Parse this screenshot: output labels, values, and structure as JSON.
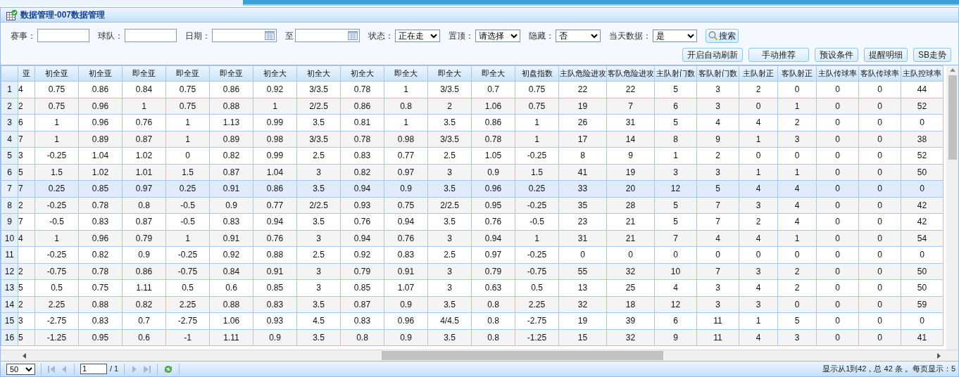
{
  "panel": {
    "title": "数据管理-007数据管理"
  },
  "filters": [
    {
      "kind": "text",
      "label": "赛事："
    },
    {
      "kind": "text",
      "label": "球队："
    },
    {
      "kind": "date",
      "label": "日期："
    },
    {
      "kind": "date",
      "label": "至"
    },
    {
      "kind": "select",
      "label": "状态：",
      "value": "正在走"
    },
    {
      "kind": "select",
      "label": "置顶：",
      "value": "请选择"
    },
    {
      "kind": "select",
      "label": "隐藏：",
      "value": "否"
    },
    {
      "kind": "select",
      "label": "当天数据：",
      "value": "是"
    }
  ],
  "search_button": "搜索",
  "actions": [
    "开启自动刷新",
    "手动推荐",
    "预设条件",
    "提醒明细",
    "SB走势"
  ],
  "table": {
    "columns": [
      "亚",
      "初全亚",
      "初全亚",
      "即全亚",
      "即全亚",
      "即全亚",
      "初全大",
      "初全大",
      "初全大",
      "即全大",
      "即全大",
      "即全大",
      "初盘指数",
      "主队危险进攻",
      "客队危险进攻",
      "主队射门数",
      "客队射门数",
      "主队射正",
      "客队射正",
      "主队传球率",
      "客队传球率",
      "主队控球率"
    ],
    "rows": [
      {
        "number": "1",
        "selected": false,
        "cells": [
          "4",
          "0.75",
          "0.86",
          "0.84",
          "0.75",
          "0.86",
          "0.92",
          "3/3.5",
          "0.78",
          "1",
          "3/3.5",
          "0.7",
          "0.75",
          "22",
          "22",
          "5",
          "3",
          "2",
          "0",
          "0",
          "0",
          "44"
        ]
      },
      {
        "number": "2",
        "selected": false,
        "cells": [
          "2",
          "0.75",
          "0.96",
          "1",
          "0.75",
          "0.88",
          "1",
          "2/2.5",
          "0.86",
          "0.8",
          "2",
          "1.06",
          "0.75",
          "19",
          "7",
          "6",
          "3",
          "0",
          "1",
          "0",
          "0",
          "52"
        ]
      },
      {
        "number": "3",
        "selected": false,
        "cells": [
          "6",
          "1",
          "0.96",
          "0.76",
          "1",
          "1.13",
          "0.99",
          "3.5",
          "0.81",
          "1",
          "3.5",
          "0.86",
          "1",
          "26",
          "31",
          "5",
          "4",
          "4",
          "2",
          "0",
          "0",
          "0"
        ]
      },
      {
        "number": "4",
        "selected": false,
        "cells": [
          "7",
          "1",
          "0.89",
          "0.87",
          "1",
          "0.89",
          "0.98",
          "3/3.5",
          "0.78",
          "0.98",
          "3/3.5",
          "0.78",
          "1",
          "17",
          "14",
          "8",
          "9",
          "1",
          "3",
          "0",
          "0",
          "38"
        ]
      },
      {
        "number": "5",
        "selected": false,
        "cells": [
          "3",
          "-0.25",
          "1.04",
          "1.02",
          "0",
          "0.82",
          "0.99",
          "2.5",
          "0.83",
          "0.77",
          "2.5",
          "1.05",
          "-0.25",
          "8",
          "9",
          "1",
          "2",
          "0",
          "0",
          "0",
          "0",
          "52"
        ]
      },
      {
        "number": "6",
        "selected": false,
        "cells": [
          "5",
          "1.5",
          "1.02",
          "1.01",
          "1.5",
          "0.87",
          "1.04",
          "3",
          "0.82",
          "0.97",
          "3",
          "0.9",
          "1.5",
          "41",
          "19",
          "3",
          "3",
          "1",
          "1",
          "0",
          "0",
          "50"
        ]
      },
      {
        "number": "7",
        "selected": true,
        "cells": [
          "7",
          "0.25",
          "0.85",
          "0.97",
          "0.25",
          "0.91",
          "0.86",
          "3.5",
          "0.94",
          "0.9",
          "3.5",
          "0.96",
          "0.25",
          "33",
          "20",
          "12",
          "5",
          "4",
          "4",
          "0",
          "0",
          "0"
        ]
      },
      {
        "number": "8",
        "selected": false,
        "cells": [
          "2",
          "-0.25",
          "0.78",
          "0.8",
          "-0.5",
          "0.9",
          "0.77",
          "2/2.5",
          "0.93",
          "0.75",
          "2/2.5",
          "0.95",
          "-0.25",
          "35",
          "28",
          "5",
          "7",
          "3",
          "4",
          "0",
          "0",
          "42"
        ]
      },
      {
        "number": "9",
        "selected": false,
        "cells": [
          "7",
          "-0.5",
          "0.83",
          "0.87",
          "-0.5",
          "0.83",
          "0.94",
          "3.5",
          "0.76",
          "0.94",
          "3.5",
          "0.76",
          "-0.5",
          "23",
          "21",
          "5",
          "7",
          "2",
          "4",
          "0",
          "0",
          "42"
        ]
      },
      {
        "number": "10",
        "selected": false,
        "cells": [
          "4",
          "1",
          "0.96",
          "0.79",
          "1",
          "0.91",
          "0.76",
          "3",
          "0.94",
          "0.76",
          "3",
          "0.94",
          "1",
          "31",
          "21",
          "7",
          "4",
          "4",
          "1",
          "0",
          "0",
          "54"
        ]
      },
      {
        "number": "11",
        "selected": false,
        "cells": [
          "",
          "-0.25",
          "0.82",
          "0.9",
          "-0.25",
          "0.92",
          "0.88",
          "2.5",
          "0.92",
          "0.83",
          "2.5",
          "0.97",
          "-0.25",
          "0",
          "0",
          "0",
          "0",
          "0",
          "0",
          "0",
          "0",
          "0"
        ]
      },
      {
        "number": "12",
        "selected": false,
        "cells": [
          "2",
          "-0.75",
          "0.78",
          "0.86",
          "-0.75",
          "0.84",
          "0.91",
          "3",
          "0.79",
          "0.91",
          "3",
          "0.79",
          "-0.75",
          "55",
          "32",
          "10",
          "7",
          "3",
          "2",
          "0",
          "0",
          "50"
        ]
      },
      {
        "number": "13",
        "selected": false,
        "cells": [
          "5",
          "0.5",
          "0.75",
          "1.11",
          "0.5",
          "0.6",
          "0.85",
          "3",
          "0.85",
          "1.07",
          "3",
          "0.63",
          "0.5",
          "13",
          "25",
          "4",
          "3",
          "4",
          "2",
          "0",
          "0",
          "50"
        ]
      },
      {
        "number": "14",
        "selected": false,
        "cells": [
          "2",
          "2.25",
          "0.88",
          "0.82",
          "2.25",
          "0.88",
          "0.83",
          "3.5",
          "0.87",
          "0.9",
          "3.5",
          "0.8",
          "2.25",
          "32",
          "18",
          "12",
          "3",
          "3",
          "0",
          "0",
          "0",
          "59"
        ]
      },
      {
        "number": "15",
        "selected": false,
        "cells": [
          "3",
          "-2.75",
          "0.83",
          "0.7",
          "-2.75",
          "1.06",
          "0.93",
          "4.5",
          "0.83",
          "0.96",
          "4/4.5",
          "0.8",
          "-2.75",
          "19",
          "39",
          "6",
          "11",
          "1",
          "5",
          "0",
          "0",
          "0"
        ]
      },
      {
        "number": "16",
        "selected": false,
        "cells": [
          "5",
          "-1.25",
          "0.95",
          "0.6",
          "-1",
          "1.11",
          "0.9",
          "3.5",
          "0.8",
          "0.9",
          "3.5",
          "0.8",
          "-1.25",
          "15",
          "32",
          "9",
          "11",
          "4",
          "3",
          "0",
          "0",
          "41"
        ]
      }
    ]
  },
  "pager": {
    "page_size": "50",
    "page": "1",
    "total_pages": "/ 1",
    "status": "显示从1到42，总 42 条 。每页显示：5"
  }
}
